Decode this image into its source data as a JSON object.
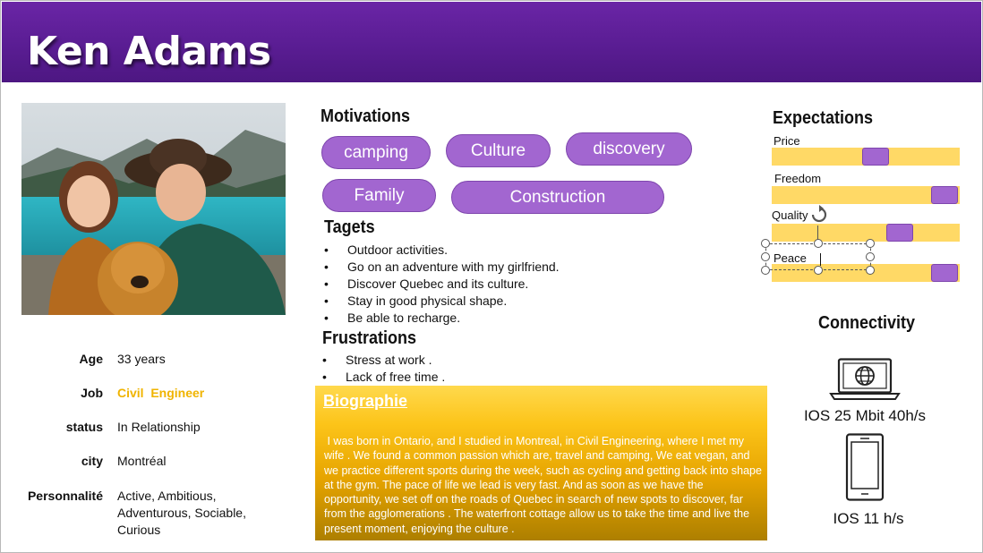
{
  "persona": {
    "name": "Ken Adams"
  },
  "info": {
    "rows": [
      {
        "label": "Age",
        "value": "33 years"
      },
      {
        "label": "Job",
        "value": "Civil  Engineer"
      },
      {
        "label": "status",
        "value": "In Relationship"
      },
      {
        "label": "city",
        "value": "Montréal"
      },
      {
        "label": "Personnalité",
        "value": "Active, Ambitious, Adventurous, Sociable, Curious"
      }
    ],
    "job_color": "#f0b400"
  },
  "motivations": {
    "title": "Motivations",
    "pills": [
      "camping",
      "Culture",
      "discovery",
      "Family",
      "Construction"
    ]
  },
  "targets": {
    "title": "Tagets",
    "items": [
      "Outdoor activities.",
      "Go on an adventure with my girlfriend.",
      "Discover Quebec and its culture.",
      "Stay in good physical shape.",
      "Be able to recharge."
    ]
  },
  "frustrations": {
    "title": "Frustrations",
    "items": [
      "Stress at work .",
      "Lack of free time ."
    ]
  },
  "biography": {
    "title": "Biographie",
    "text": " I was born in Ontario, and I studied in Montreal, in Civil Engineering, where I met my wife . We found a common passion which are, travel and camping, We eat vegan, and we practice different sports during the week, such as cycling and getting back into shape at the gym. The pace of life we lead is very fast. And as soon as we have the opportunity, we set off on the roads of Quebec in search of new spots to discover, far from the agglomerations . The waterfront cottage allow us to take the time and live the present moment, enjoying the culture ."
  },
  "expectations": {
    "title": "Expectations",
    "items": [
      {
        "label": "Price",
        "level": 0.55
      },
      {
        "label": "Freedom",
        "level": 0.92
      },
      {
        "label": "Quality",
        "level": 0.68
      },
      {
        "label": "Peace",
        "level": 0.92
      }
    ]
  },
  "connectivity": {
    "title": "Connectivity",
    "laptop": "IOS 25 Mbit 40h/s",
    "phone": "IOS 11 h/s"
  },
  "colors": {
    "header_purple": "#5a1d93",
    "pill_purple": "#a266d0",
    "track_yellow": "#ffd966",
    "bio_gold": "#e6a400"
  },
  "icons": [
    "laptop-globe-icon",
    "smartphone-icon",
    "rotate-handle-icon"
  ]
}
